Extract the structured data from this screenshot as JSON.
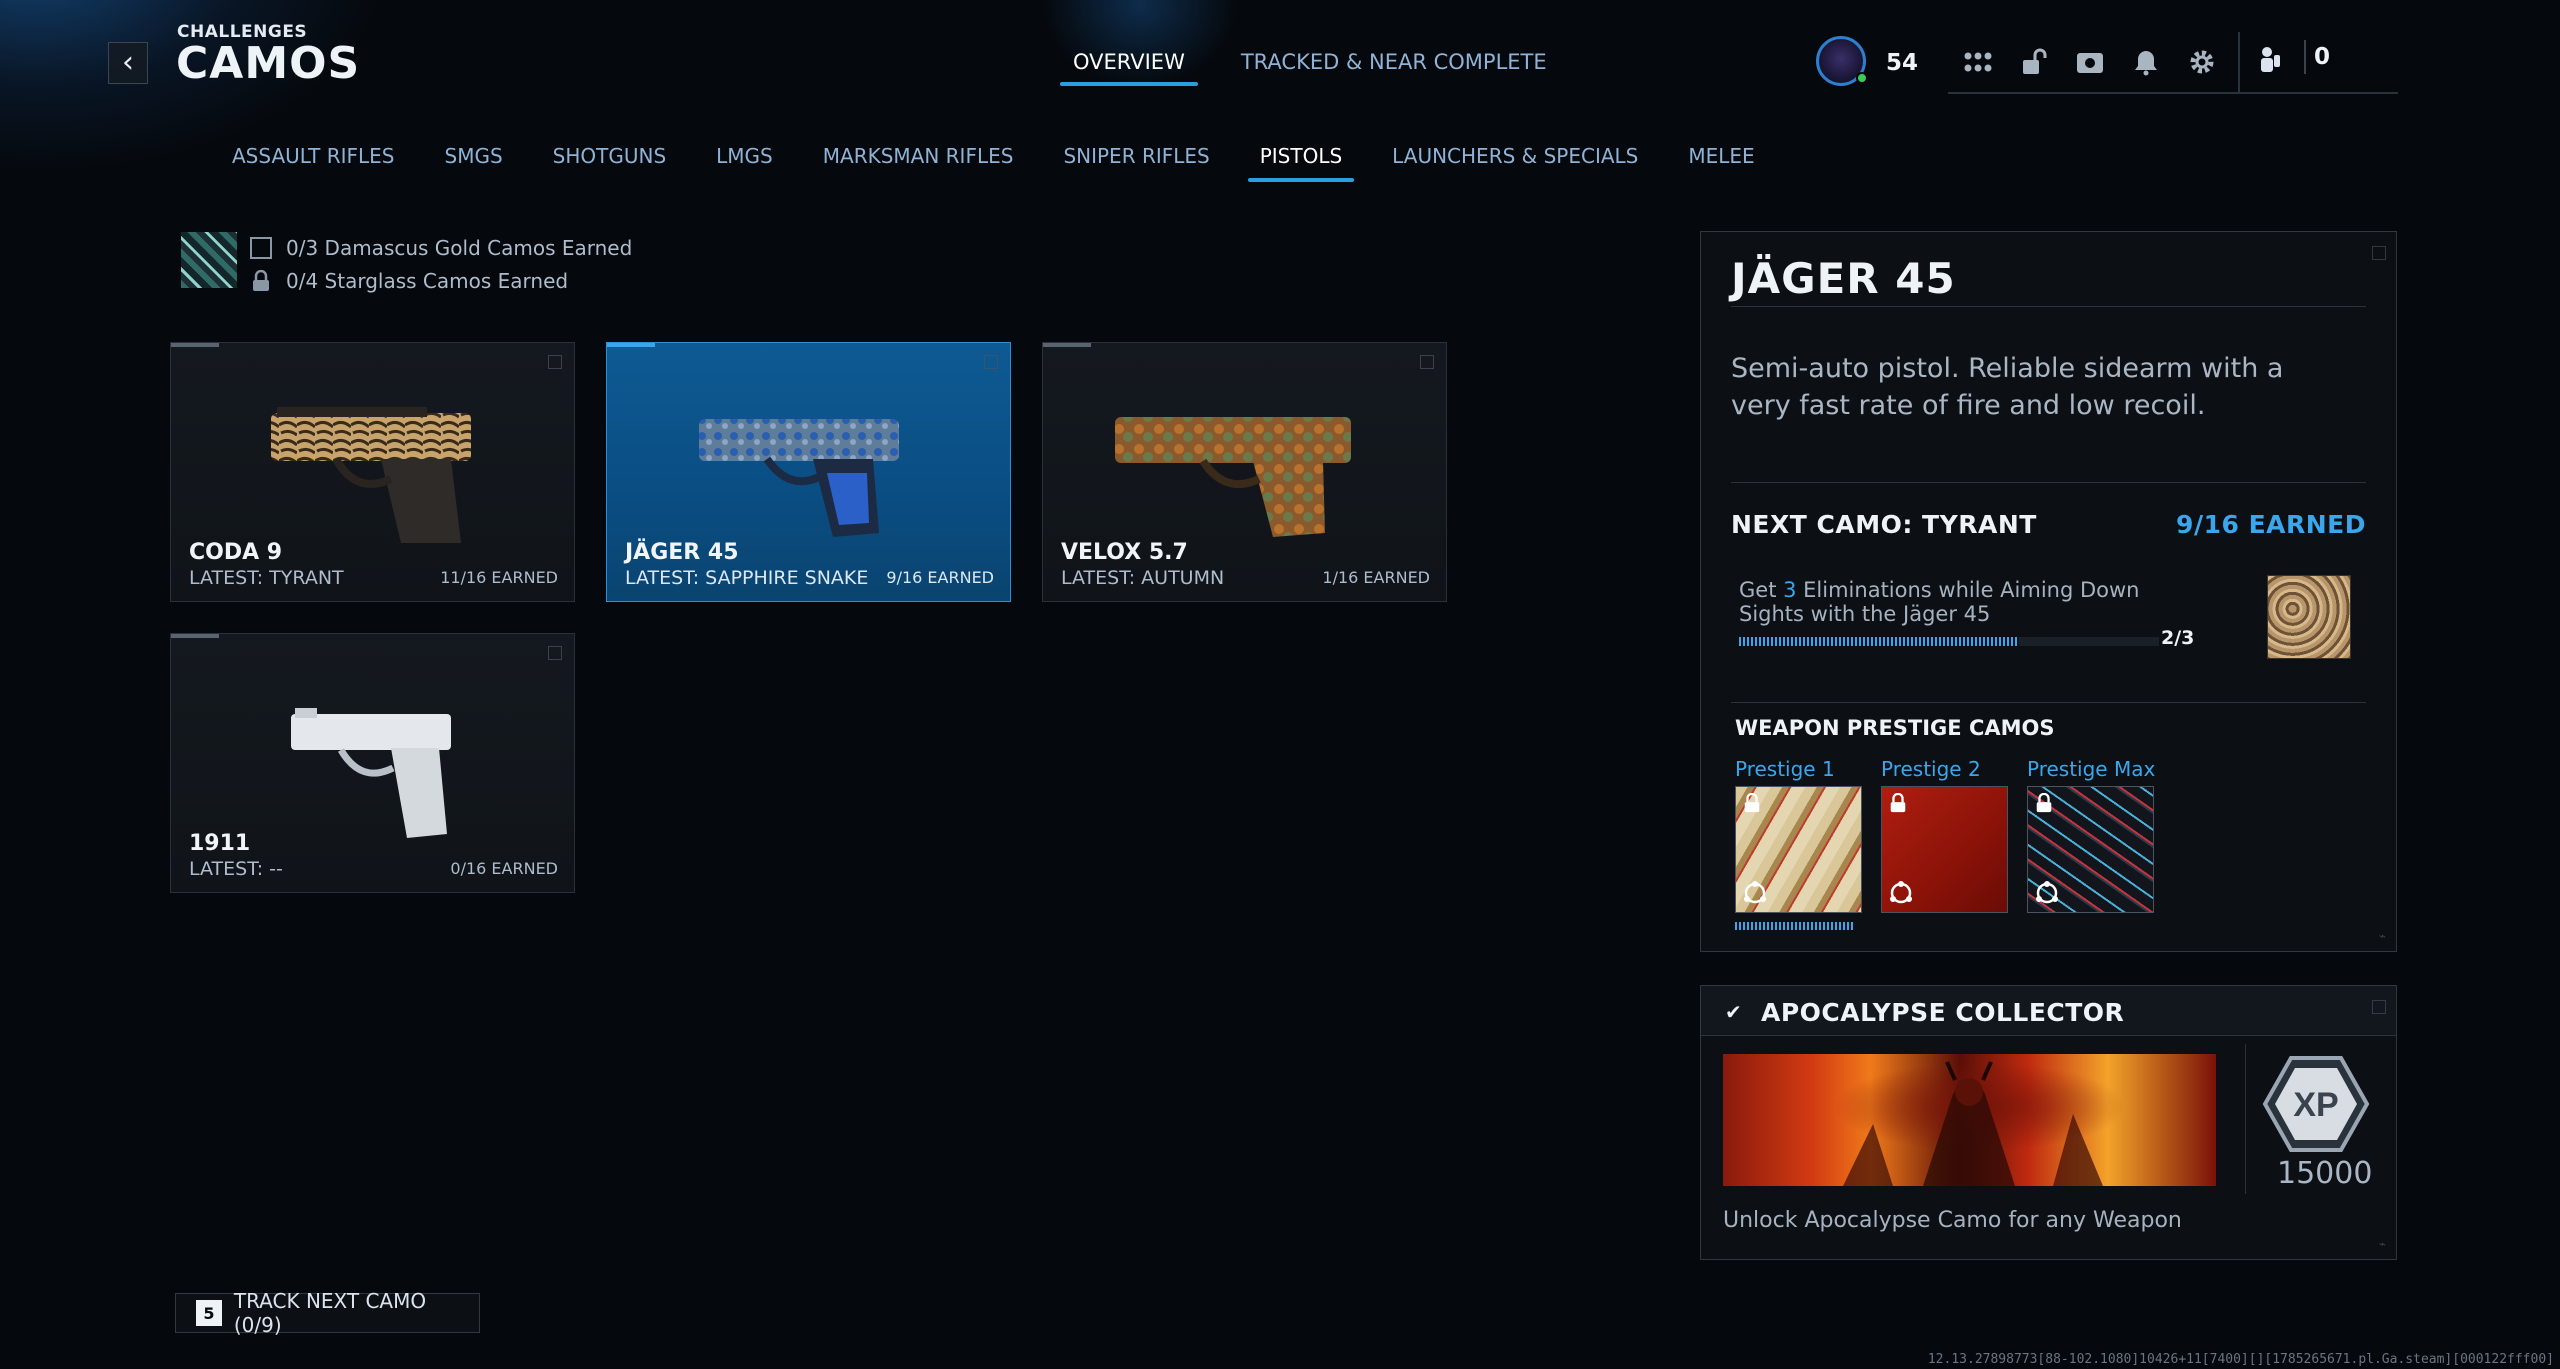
{
  "header": {
    "subtitle": "CHALLENGES",
    "title": "CAMOS",
    "tabs": [
      {
        "label": "OVERVIEW",
        "active": true
      },
      {
        "label": "TRACKED & NEAR COMPLETE",
        "active": false
      }
    ]
  },
  "hud": {
    "level": "54",
    "icons": [
      "grid-icon",
      "unlock-icon",
      "camera-icon",
      "bell-icon",
      "gear-icon"
    ],
    "currency_icon": "operator-icon",
    "currency": "0"
  },
  "categories": [
    {
      "label": "ASSAULT RIFLES",
      "active": false
    },
    {
      "label": "SMGS",
      "active": false
    },
    {
      "label": "SHOTGUNS",
      "active": false
    },
    {
      "label": "LMGS",
      "active": false
    },
    {
      "label": "MARKSMAN RIFLES",
      "active": false
    },
    {
      "label": "SNIPER RIFLES",
      "active": false
    },
    {
      "label": "PISTOLS",
      "active": true
    },
    {
      "label": "LAUNCHERS & SPECIALS",
      "active": false
    },
    {
      "label": "MELEE",
      "active": false
    }
  ],
  "summary": {
    "damascus": "0/3 Damascus Gold Camos Earned",
    "starglass": "0/4 Starglass Camos Earned"
  },
  "weapons": [
    {
      "name": "CODA 9",
      "latest": "LATEST: TYRANT",
      "earned": "11/16 EARNED",
      "selected": false
    },
    {
      "name": "JÄGER 45",
      "latest": "LATEST: SAPPHIRE SNAKE",
      "earned": "9/16 EARNED",
      "selected": true
    },
    {
      "name": "VELOX 5.7",
      "latest": "LATEST: AUTUMN",
      "earned": "1/16 EARNED",
      "selected": false
    },
    {
      "name": "1911",
      "latest": "LATEST: --",
      "earned": "0/16 EARNED",
      "selected": false
    }
  ],
  "detail": {
    "title": "JÄGER 45",
    "description": "Semi-auto pistol. Reliable sidearm with a very fast rate of fire and low recoil.",
    "next_camo": "NEXT CAMO: TYRANT",
    "earned": "9/16 EARNED",
    "challenge_pre": "Get ",
    "challenge_num": "3",
    "challenge_post": " Eliminations while Aiming Down Sights with the Jäger 45",
    "progress_text": "2/3",
    "progress_fraction": 0.667,
    "prestige_heading": "WEAPON PRESTIGE CAMOS",
    "prestige": [
      {
        "label": "Prestige 1"
      },
      {
        "label": "Prestige 2"
      },
      {
        "label": "Prestige Max"
      }
    ]
  },
  "collector": {
    "title": "APOCALYPSE COLLECTOR",
    "xp": "15000",
    "description": "Unlock Apocalypse Camo for any Weapon"
  },
  "track": {
    "key": "5",
    "label": "TRACK NEXT CAMO (0/9)"
  },
  "build": "12.13.27898773[88-102.1080]10426+11[7400][][1785265671.pl.Ga.steam][000122fff00]",
  "colors": {
    "accent": "#3aa6ec",
    "selected_card": "#0e5a93",
    "background": "#05080c"
  }
}
